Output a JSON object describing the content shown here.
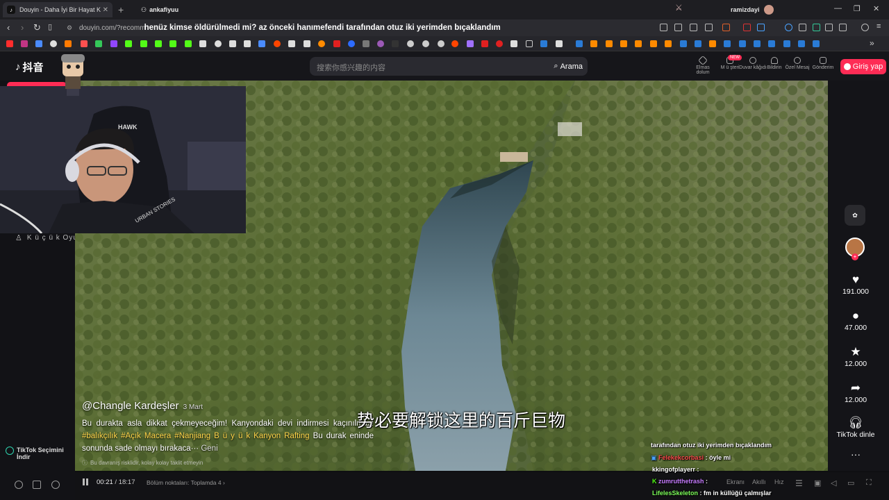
{
  "browser": {
    "active_tab": "Douyin - Daha İyi Bir Hayat K",
    "profile_tab": "ankafiyuu",
    "user": "ramizdayi",
    "url": "douyin.com/?recomm",
    "page_overlay_title": "henüz kimse öldürülmedi mi? az önceki hanımefendi tarafından otuz iki yerimden bıçaklandım"
  },
  "header": {
    "logo": "抖音",
    "search_placeholder": "搜索你感兴趣的内容",
    "search_button": "Arama",
    "nav": [
      {
        "label": "Elmas dolum"
      },
      {
        "label": "M ü şteri",
        "badge": "NEW"
      },
      {
        "label": "Duvar kâğıdı"
      },
      {
        "label": "Bildirin"
      },
      {
        "label": "Özel Mesaj"
      },
      {
        "label": "Gönderim"
      }
    ],
    "login": "Giriş yap"
  },
  "sidebar": {
    "small_game": "K ü ç ü k Oyu",
    "tiktok_picks": "TikTok Seçimini İndir"
  },
  "video": {
    "author": "@Changle Kardeşler",
    "date": "3 Mart",
    "desc_text": "Bu durakta asla dikkat çekmeyeceğim! Kanyondaki devi indirmesi kaçınılmaz!",
    "tags": [
      "#balıkçılık",
      "#Açık Macera",
      "#Nanjiang B ü y ü k Kanyon Rafting"
    ],
    "desc_tail": "Bu durak eninde sonunda sade olmayı bırakaca···",
    "more": "Geni",
    "risk_notice": "Bu davranış risklidir, kolay kolay taklit etmeyin",
    "subtitle": "势必要解锁这里的百斤巨物"
  },
  "actions": {
    "likes": "191.000",
    "comments": "47.000",
    "favorites": "12.000",
    "shares": "12.000",
    "listen": "TikTok dinle"
  },
  "player": {
    "current": "00:21",
    "total": "18:17",
    "chapters": "Bölüm noktaları: Toplamda 4",
    "screen": "Ekranı",
    "smart": "Akıllı",
    "speed": "Hız"
  },
  "chat": [
    {
      "user": "",
      "msg": "tarafından otuz iki yerimden bıçaklandım",
      "color": "#ffffff"
    },
    {
      "user": "Felekekcorbasi",
      "msg": ": öyle mi",
      "color": "#ff4d4d"
    },
    {
      "user": "kkingofplayerr",
      "msg": ":",
      "color": "#ffffff"
    },
    {
      "user": "zumrutthetrash",
      "msg": ":",
      "color": "#c77dff"
    },
    {
      "user": "LifelesSkeleton",
      "msg": ": fm in küllüğü çalmışlar",
      "color": "#7dff5a"
    }
  ],
  "colors": {
    "accent": "#fe2c55",
    "tag": "#ffd54a"
  }
}
